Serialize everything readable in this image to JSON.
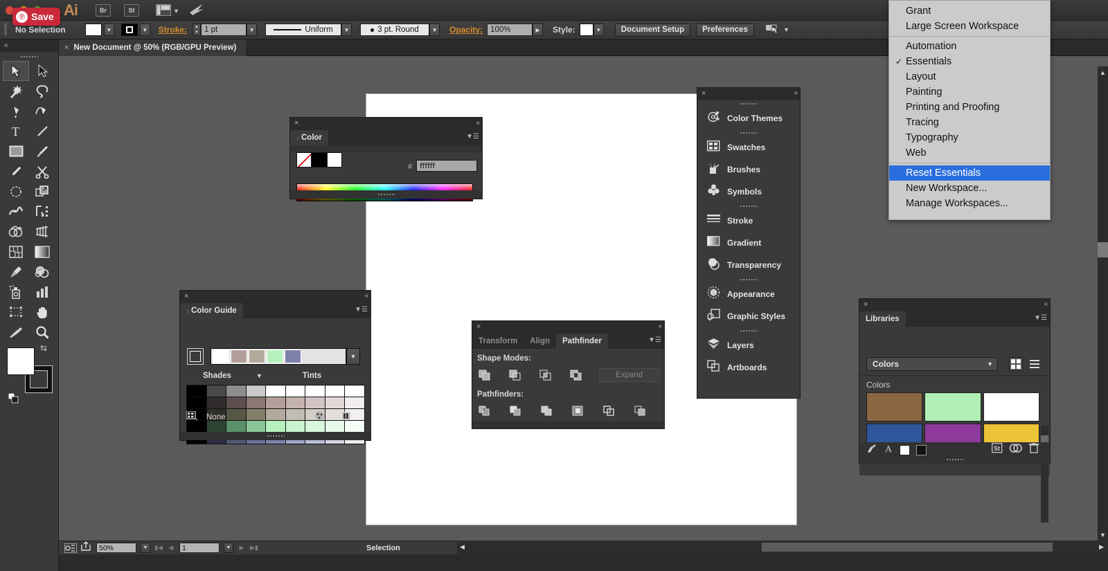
{
  "app": {
    "name": "Adobe Illustrator",
    "logo_text": "Ai",
    "bridge_label": "Br",
    "stock_label": "St"
  },
  "overlay": {
    "pinterest_save_label": "Save",
    "pinterest_glyph": "℗"
  },
  "control_bar": {
    "selection_status": "No Selection",
    "stroke_label": "Stroke:",
    "stroke_weight": "1 pt",
    "profile_label": "Uniform",
    "brush_label": "3 pt. Round",
    "opacity_label": "Opacity:",
    "opacity_value": "100%",
    "style_label": "Style:",
    "document_setup_label": "Document Setup",
    "preferences_label": "Preferences",
    "fill_color": "#ffffff"
  },
  "document_tab": {
    "title": "New Document @ 50% (RGB/GPU Preview)",
    "close_glyph": "×"
  },
  "workspace_menu": {
    "items": [
      {
        "label": "Grant",
        "checked": false,
        "selected": false
      },
      {
        "label": "Large Screen Workspace",
        "checked": false,
        "selected": false
      },
      {
        "separator": true
      },
      {
        "label": "Automation",
        "checked": false,
        "selected": false
      },
      {
        "label": "Essentials",
        "checked": true,
        "selected": false
      },
      {
        "label": "Layout",
        "checked": false,
        "selected": false
      },
      {
        "label": "Painting",
        "checked": false,
        "selected": false
      },
      {
        "label": "Printing and Proofing",
        "checked": false,
        "selected": false
      },
      {
        "label": "Tracing",
        "checked": false,
        "selected": false
      },
      {
        "label": "Typography",
        "checked": false,
        "selected": false
      },
      {
        "label": "Web",
        "checked": false,
        "selected": false
      },
      {
        "separator": true
      },
      {
        "label": "Reset Essentials",
        "checked": false,
        "selected": true
      },
      {
        "label": "New Workspace...",
        "checked": false,
        "selected": false
      },
      {
        "label": "Manage Workspaces...",
        "checked": false,
        "selected": false
      }
    ],
    "check_glyph": "✓",
    "highlight_color": "#2a6ede"
  },
  "color_panel": {
    "tab_label": "Color",
    "hash_symbol": "#",
    "hex_value": "ffffff",
    "swatches": [
      "none",
      "#000000",
      "#ffffff"
    ],
    "close_glyph": "×"
  },
  "color_guide_panel": {
    "tab_label": "Color Guide",
    "shades_label": "Shades",
    "tints_label": "Tints",
    "footer_label": "None",
    "harmony_colors": [
      "#ffffff",
      "#b49e9c",
      "#b2aa9c",
      "#b7f0bf",
      "#7d82ab"
    ],
    "base_color": "#ffffff",
    "grid_rows": [
      [
        "#000000",
        "#4a4a4a",
        "#8d8d8d",
        "#c9c9c9",
        "#ffffff",
        "#ffffff",
        "#ffffff",
        "#ffffff",
        "#ffffff"
      ],
      [
        "#000000",
        "#332c2c",
        "#5d4f4e",
        "#8a7674",
        "#b49e9c",
        "#c4b2b0",
        "#d2c4c3",
        "#e2d8d7",
        "#f2eeee"
      ],
      [
        "#000000",
        "#2f2f26",
        "#565644",
        "#827f6b",
        "#b2aa9c",
        "#c2bcb1",
        "#d2cdc5",
        "#e3dfda",
        "#f2f0ee"
      ],
      [
        "#000000",
        "#2c4431",
        "#5b9168",
        "#8ac796",
        "#b7f0bf",
        "#c8f3ce",
        "#d8f7dc",
        "#e8faeb",
        "#f5fdf7"
      ],
      [
        "#000000",
        "#2b2d41",
        "#555a78",
        "#6c729a",
        "#7d82ab",
        "#a1a5c4",
        "#bcbfd6",
        "#d4d6e6",
        "#eceef4"
      ]
    ],
    "close_glyph": "×"
  },
  "pathfinder_panel": {
    "tabs": [
      {
        "label": "Transform",
        "active": false
      },
      {
        "label": "Align",
        "active": false
      },
      {
        "label": "Pathfinder",
        "active": true
      }
    ],
    "shape_modes_label": "Shape Modes:",
    "pathfinders_label": "Pathfinders:",
    "expand_label": "Expand",
    "shape_mode_buttons": [
      "unite",
      "minus-front",
      "intersect",
      "exclude"
    ],
    "pathfinder_buttons": [
      "divide",
      "trim",
      "merge",
      "crop",
      "outline",
      "minus-back"
    ],
    "close_glyph": "×"
  },
  "dock": {
    "groups": [
      {
        "items": [
          {
            "label": "Color Themes",
            "icon": "color-themes-icon"
          }
        ]
      },
      {
        "items": [
          {
            "label": "Swatches",
            "icon": "swatches-icon"
          },
          {
            "label": "Brushes",
            "icon": "brushes-icon"
          },
          {
            "label": "Symbols",
            "icon": "symbols-icon"
          }
        ]
      },
      {
        "items": [
          {
            "label": "Stroke",
            "icon": "stroke-icon"
          },
          {
            "label": "Gradient",
            "icon": "gradient-icon"
          },
          {
            "label": "Transparency",
            "icon": "transparency-icon"
          }
        ]
      },
      {
        "items": [
          {
            "label": "Appearance",
            "icon": "appearance-icon"
          },
          {
            "label": "Graphic Styles",
            "icon": "graphic-styles-icon"
          }
        ]
      },
      {
        "items": [
          {
            "label": "Layers",
            "icon": "layers-icon"
          },
          {
            "label": "Artboards",
            "icon": "artboards-icon"
          }
        ]
      }
    ],
    "close_glyph": "×"
  },
  "libraries_panel": {
    "tab_label": "Libraries",
    "selected_library": "Colors",
    "group_title": "Colors",
    "swatches": [
      "#8a6643",
      "#b0f0b4",
      "#ffffff",
      "#2f559b",
      "#8e3a9c",
      "#edc337"
    ],
    "close_glyph": "×"
  },
  "status_bar": {
    "zoom_value": "50%",
    "page_value": "1",
    "status_text": "Selection"
  },
  "toolbar": {
    "tools": [
      "selection-tool",
      "direct-selection-tool",
      "magic-wand-tool",
      "lasso-tool",
      "pen-tool",
      "curvature-tool",
      "type-tool",
      "line-segment-tool",
      "rectangle-tool",
      "paintbrush-tool",
      "pencil-tool",
      "scissors-tool",
      "rotate-tool",
      "scale-tool",
      "width-tool",
      "free-transform-tool",
      "shape-builder-tool",
      "perspective-grid-tool",
      "mesh-tool",
      "gradient-tool",
      "eyedropper-tool",
      "blend-tool",
      "symbol-sprayer-tool",
      "column-graph-tool",
      "artboard-tool",
      "hand-tool",
      "slice-tool",
      "zoom-tool"
    ],
    "fill_color": "#ffffff",
    "stroke_color": "#000000"
  },
  "colors": {
    "panel_bg": "#3a3a3a",
    "panel_header_bg": "#2b2b2b",
    "chrome_bg": "#3b3b3b",
    "canvas_bg": "#5a5a5a",
    "accent_orange": "#d98c2b",
    "highlight_blue": "#2a6ede",
    "pinterest_red": "#c9293a"
  }
}
